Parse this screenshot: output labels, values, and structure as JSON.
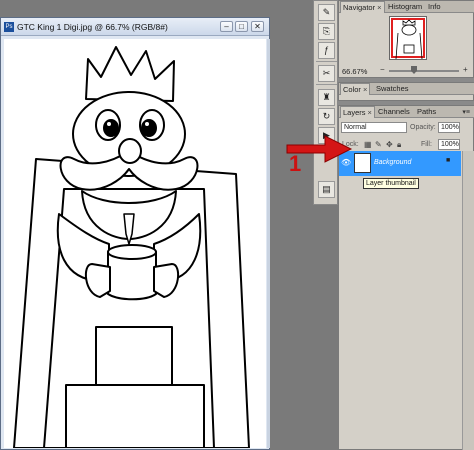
{
  "document": {
    "icon_label": "Ps",
    "title": "GTC King 1 Digi.jpg @ 66.7% (RGB/8#)",
    "min_btn": "–",
    "max_btn": "□",
    "close_btn": "✕"
  },
  "navigator_panel": {
    "tabs": [
      {
        "label": "Navigator",
        "close": "×"
      },
      {
        "label": "Histogram"
      },
      {
        "label": "Info"
      }
    ],
    "zoom": "66.67%",
    "minus": "−",
    "plus": "+"
  },
  "color_panel": {
    "tabs": [
      {
        "label": "Color",
        "close": "×"
      },
      {
        "label": "Swatches"
      }
    ]
  },
  "layers_panel": {
    "tabs": [
      {
        "label": "Layers",
        "close": "×"
      },
      {
        "label": "Channels"
      },
      {
        "label": "Paths"
      }
    ],
    "blend_mode": "Normal",
    "opacity_label": "Opacity:",
    "opacity": "100%",
    "lock_label": "Lock:",
    "fill_label": "Fill:",
    "fill": "100%",
    "layer_name": "Background",
    "tooltip": "Layer thumbnail"
  },
  "annotation": {
    "number": "1"
  },
  "colors": {
    "selection": "#3399ff",
    "annotation": "#cc1111",
    "nav_box": "#e02020"
  }
}
